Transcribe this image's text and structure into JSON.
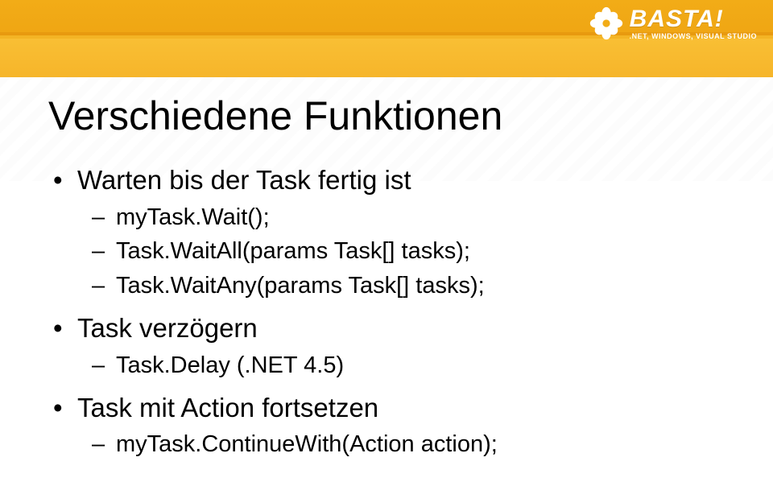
{
  "logo": {
    "brand": "BASTA!",
    "subline": ".NET, WINDOWS, VISUAL STUDIO"
  },
  "slide": {
    "title": "Verschiedene Funktionen",
    "bullets": [
      {
        "text": "Warten bis der Task fertig ist",
        "sub": [
          "myTask.Wait();",
          "Task.WaitAll(params Task[] tasks);",
          "Task.WaitAny(params Task[] tasks);"
        ]
      },
      {
        "text": "Task verzögern",
        "sub": [
          "Task.Delay (.NET 4.5)"
        ]
      },
      {
        "text": "Task mit Action fortsetzen",
        "sub": [
          "myTask.ContinueWith(Action action);"
        ]
      }
    ]
  }
}
